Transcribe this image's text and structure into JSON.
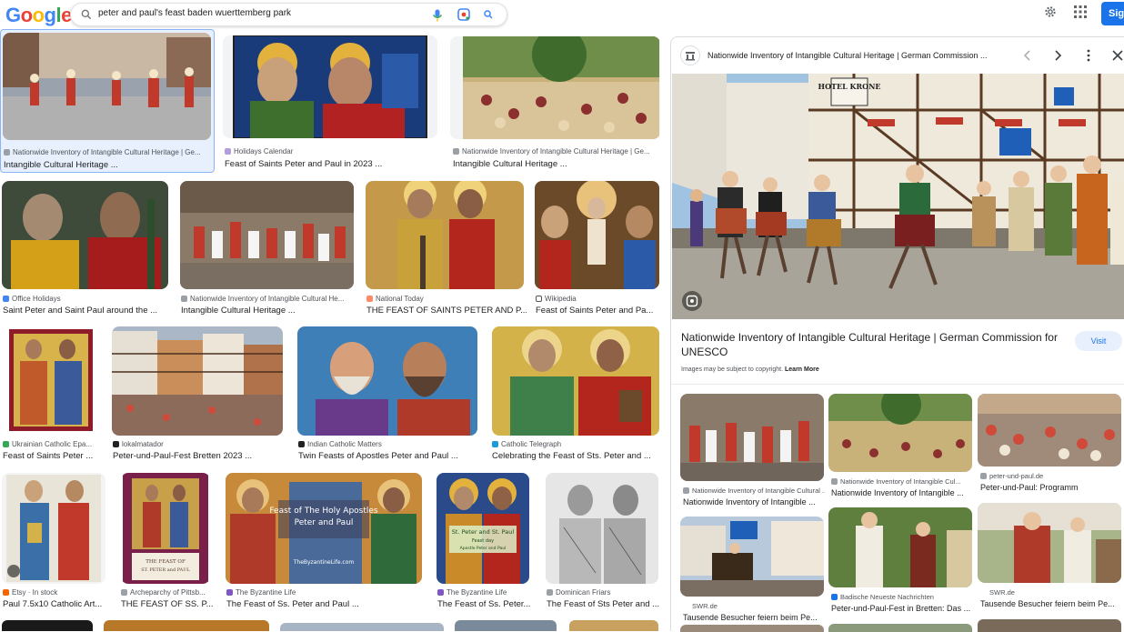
{
  "search": {
    "query": "peter and paul's feast baden wuerttemberg park"
  },
  "header": {
    "sign_in_label": "Sig"
  },
  "results": [
    {
      "source": "Nationwide Inventory of Intangible Cultural Heritage | Ge...",
      "title": "Intangible Cultural Heritage ..."
    },
    {
      "source": "Holidays Calendar",
      "title": "Feast of Saints Peter and Paul in 2023 ..."
    },
    {
      "source": "Nationwide Inventory of Intangible Cultural Heritage | Ge...",
      "title": "Intangible Cultural Heritage ..."
    },
    {
      "source": "Office Holidays",
      "title": "Saint Peter and Saint Paul around the ..."
    },
    {
      "source": "Nationwide Inventory of Intangible Cultural He...",
      "title": "Intangible Cultural Heritage ..."
    },
    {
      "source": "National Today",
      "title": "THE FEAST OF SAINTS PETER AND P..."
    },
    {
      "source": "Wikipedia",
      "title": "Feast of Saints Peter and Pa..."
    },
    {
      "source": "Ukrainian Catholic Epa...",
      "title": "Feast of Saints Peter ..."
    },
    {
      "source": "lokalmatador",
      "title": "Peter-und-Paul-Fest Bretten 2023 ..."
    },
    {
      "source": "Indian Catholic Matters",
      "title": "Twin Feasts of Apostles Peter and Paul ..."
    },
    {
      "source": "Catholic Telegraph",
      "title": "Celebrating the Feast of Sts. Peter and ..."
    },
    {
      "source": "Etsy · In stock",
      "title": "Paul 7.5x10 Catholic Art..."
    },
    {
      "source": "Archeparchy of Pittsb...",
      "title": "THE FEAST OF SS. P..."
    },
    {
      "source": "The Byzantine Life",
      "title": "The Feast of Ss. Peter and Paul ..."
    },
    {
      "source": "The Byzantine Life",
      "title": "The Feast of Ss. Peter..."
    },
    {
      "source": "Dominican Friars",
      "title": "The Feast of Sts Peter and ..."
    }
  ],
  "image_texts": {
    "byz_banner_1": "Feast of The Holy Apostles",
    "byz_banner_2": "Peter and Paul",
    "byz_url": "TheByzantineLife.com",
    "icon_label_1": "St. Peter and St. Paul",
    "icon_label_2": "Feast day",
    "icon_label_3": "Apostle Peter and Paul",
    "arch_line_1": "THE FEAST OF",
    "arch_line_2": "ST. PETER and PAUL",
    "hotel_sign": "HOTEL KRONE"
  },
  "panel": {
    "source": "Nationwide Inventory of Intangible Cultural Heritage | German Commission ...",
    "title": "Nationwide Inventory of Intangible Cultural Heritage | German Commission for UNESCO",
    "visit_label": "Visit",
    "copyright_text": "Images may be subject to copyright.",
    "learn_more": "Learn More",
    "related": [
      {
        "source": "Nationwide Inventory of Intangible Cultural ...",
        "title": "Nationwide Inventory of Intangible ..."
      },
      {
        "source": "Nationwide Inventory of Intangible Cul...",
        "title": "Nationwide Inventory of Intangible ..."
      },
      {
        "source": "peter-und-paul.de",
        "title": "Peter-und-Paul: Programm"
      },
      {
        "source": "SWR.de",
        "title": "Tausende Besucher feiern beim Pe..."
      },
      {
        "source": "Badische Neueste Nachrichten",
        "title": "Peter-und-Paul-Fest in Bretten: Das ..."
      },
      {
        "source": "SWR.de",
        "title": "Tausende Besucher feiern beim Pe..."
      }
    ]
  },
  "colors": {
    "accent": "#1a73e8",
    "google_blue": "#4285f4",
    "google_red": "#ea4335",
    "google_yellow": "#fbbc05",
    "google_green": "#34a853"
  }
}
